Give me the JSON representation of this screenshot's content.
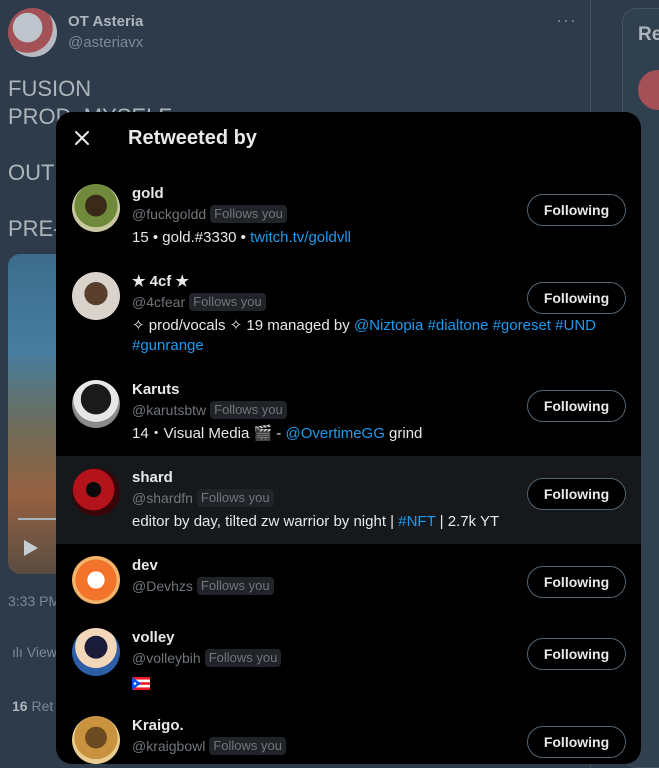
{
  "background_tweet": {
    "author_name": "OT Asteria",
    "author_handle": "@asteriavx",
    "lines": [
      "FUSION",
      "PROD. MYSELF",
      "OUT",
      "PRE-"
    ],
    "time": "3:33 PM",
    "views_label": "View",
    "retweet_count": "16",
    "retweet_label": "Ret",
    "more_icon": "more-icon"
  },
  "side_panel": {
    "title_partial": "Re"
  },
  "modal": {
    "title": "Retweeted by",
    "close_icon": "close-icon",
    "users": [
      {
        "name": "gold",
        "handle": "@fuckgoldd",
        "follows_you": "Follows you",
        "button": "Following",
        "bio": [
          {
            "text": "15 • gold.#3330 • ",
            "link": false
          },
          {
            "text": "twitch.tv/goldvll",
            "link": true
          }
        ]
      },
      {
        "name": "★ 4cf ★",
        "handle": "@4cfear",
        "follows_you": "Follows you",
        "button": "Following",
        "bio": [
          {
            "text": "✧ prod/vocals ✧ 19 managed by ",
            "link": false
          },
          {
            "text": "@Niztopia",
            "link": true
          },
          {
            "text": " ",
            "link": false
          },
          {
            "text": "#dialtone",
            "link": true
          },
          {
            "text": " ",
            "link": false
          },
          {
            "text": "#goreset",
            "link": true
          },
          {
            "text": " ",
            "link": false
          },
          {
            "text": "#UND",
            "link": true
          },
          {
            "text": " ",
            "link": false
          },
          {
            "text": "#gunrange",
            "link": true
          }
        ]
      },
      {
        "name": "Karuts",
        "handle": "@karutsbtw",
        "follows_you": "Follows you",
        "button": "Following",
        "bio": [
          {
            "text": "14・Visual Media 🎬 - ",
            "link": false
          },
          {
            "text": "@OvertimeGG",
            "link": true
          },
          {
            "text": " grind",
            "link": false
          }
        ]
      },
      {
        "name": "shard",
        "handle": "@shardfn",
        "follows_you": "Follows you",
        "button": "Following",
        "hover": true,
        "bio": [
          {
            "text": "editor by day, tilted zw warrior by night | ",
            "link": false
          },
          {
            "text": "#NFT",
            "link": true
          },
          {
            "text": " | 2.7k YT",
            "link": false
          }
        ]
      },
      {
        "name": "dev",
        "handle": "@Devhzs",
        "follows_you": "Follows you",
        "button": "Following",
        "bio": []
      },
      {
        "name": "volley",
        "handle": "@volleybih",
        "follows_you": "Follows you",
        "button": "Following",
        "flag": "puerto-rico-flag-icon",
        "bio": []
      },
      {
        "name": "Kraigo.",
        "handle": "@kraigbowl",
        "follows_you": "Follows you",
        "button": "Following",
        "bio": []
      }
    ]
  },
  "colors": {
    "link": "#1d9bf0",
    "modal_bg": "#000000",
    "page_bg": "#15202b",
    "muted": "#71767b"
  }
}
